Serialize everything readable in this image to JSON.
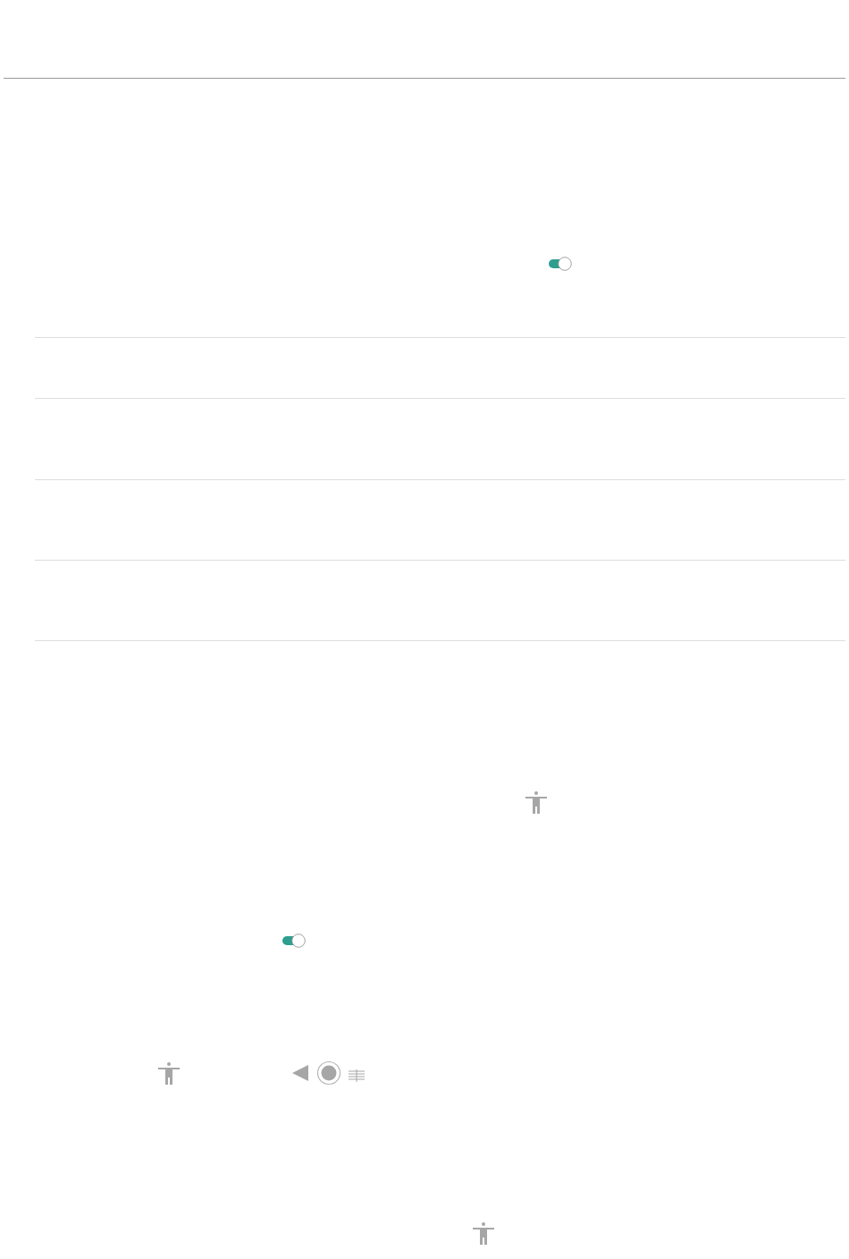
{
  "toggles": [
    {
      "on": true
    },
    {
      "on": true
    }
  ]
}
